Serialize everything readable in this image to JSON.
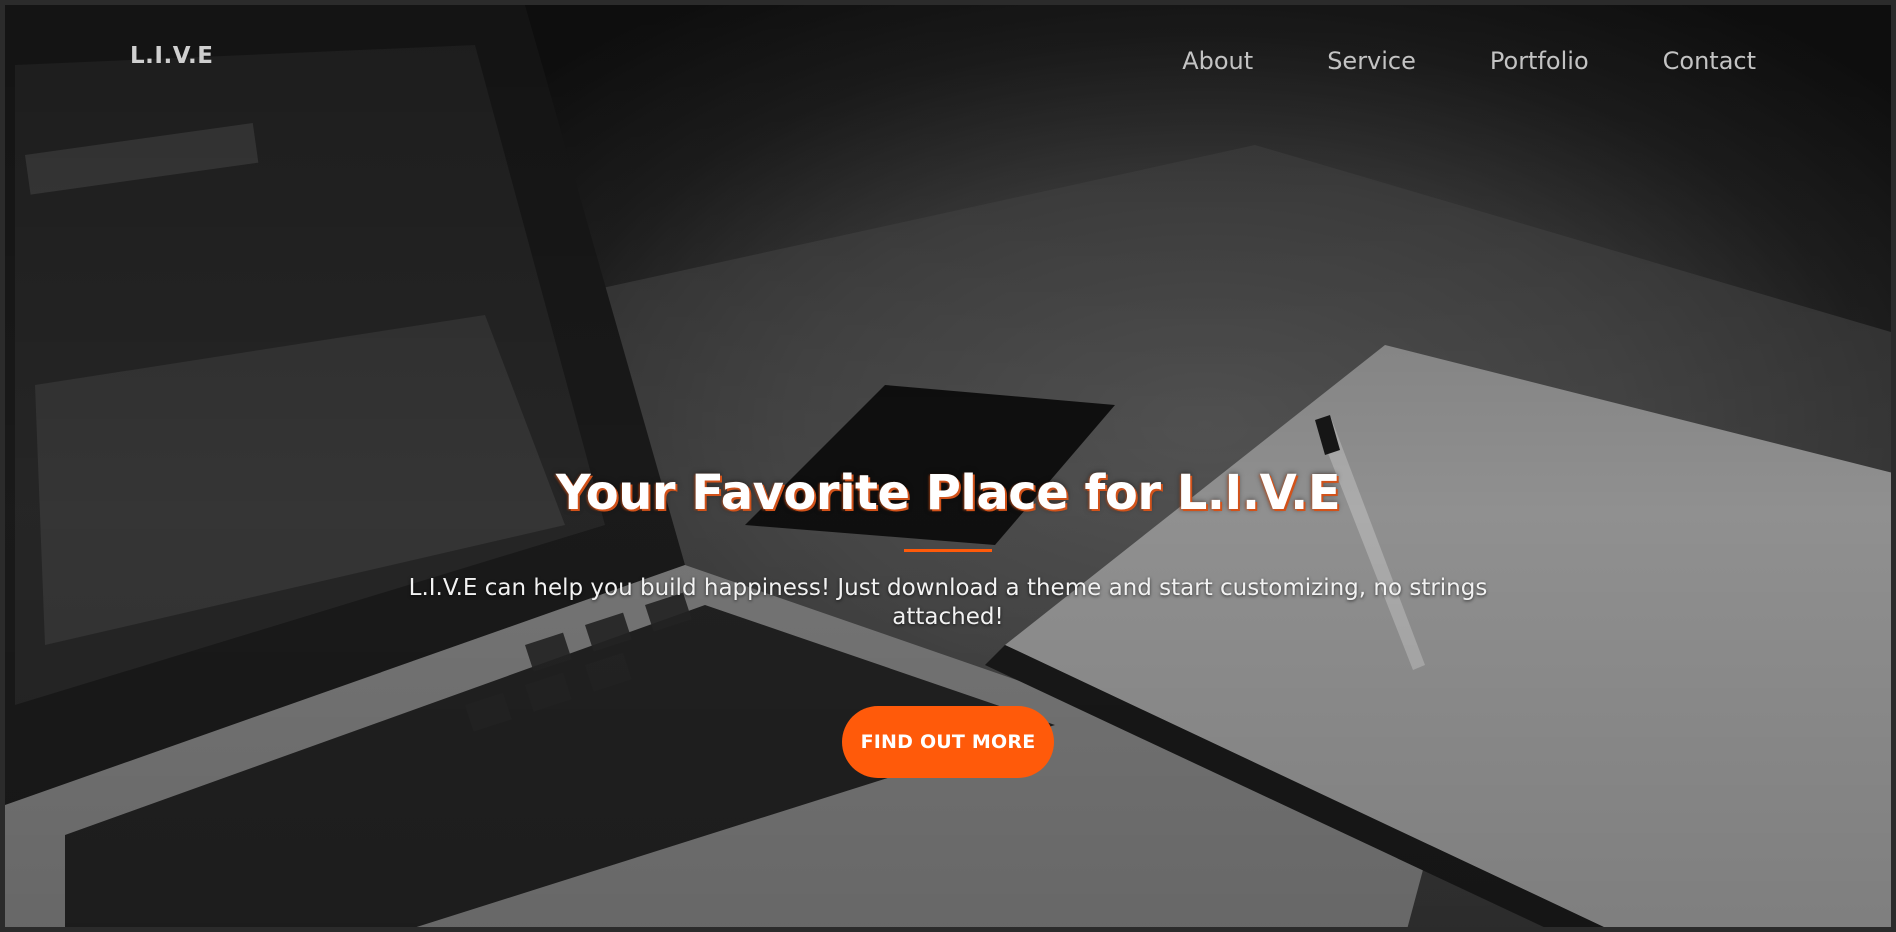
{
  "nav": {
    "brand": "L.I.V.E",
    "links": [
      {
        "label": "About"
      },
      {
        "label": "Service"
      },
      {
        "label": "Portfolio"
      },
      {
        "label": "Contact"
      }
    ]
  },
  "hero": {
    "title": "Your Favorite Place for L.I.V.E",
    "subtitle": "L.I.V.E can help you build happiness! Just download a theme and start customizing, no strings attached!",
    "cta_label": "FIND OUT MORE",
    "background_description_icon": "laptop-desk-photo"
  },
  "colors": {
    "accent": "#ff5a0a",
    "nav_text": "#c3c3c3",
    "hero_text": "#ffffff"
  }
}
